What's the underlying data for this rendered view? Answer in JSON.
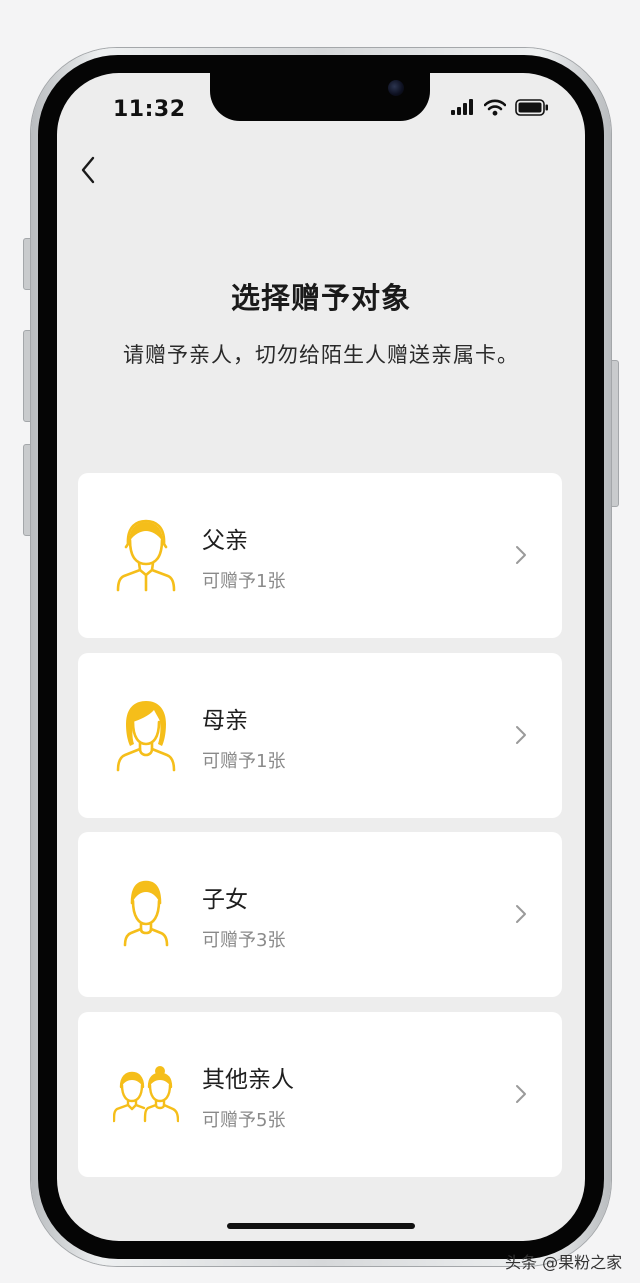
{
  "status_bar": {
    "time": "11:32",
    "signal_icon": "cellular-signal-icon",
    "wifi_icon": "wifi-icon",
    "battery_icon": "battery-icon"
  },
  "header": {
    "back_icon": "chevron-left-icon",
    "title": "选择赠予对象",
    "subtitle": "请赠予亲人，切勿给陌生人赠送亲属卡。"
  },
  "recipients": [
    {
      "label": "父亲",
      "sub": "可赠予1张",
      "icon": "father-avatar-icon"
    },
    {
      "label": "母亲",
      "sub": "可赠予1张",
      "icon": "mother-avatar-icon"
    },
    {
      "label": "子女",
      "sub": "可赠予3张",
      "icon": "child-avatar-icon"
    },
    {
      "label": "其他亲人",
      "sub": "可赠予5张",
      "icon": "other-relatives-icon"
    }
  ],
  "colors": {
    "accent_icon": "#f5be1a",
    "screen_background": "#ededed",
    "card_background": "#ffffff",
    "title_text": "#1a1a1a",
    "secondary_text": "#8a8a8a"
  },
  "watermark": "头条 @果粉之家"
}
